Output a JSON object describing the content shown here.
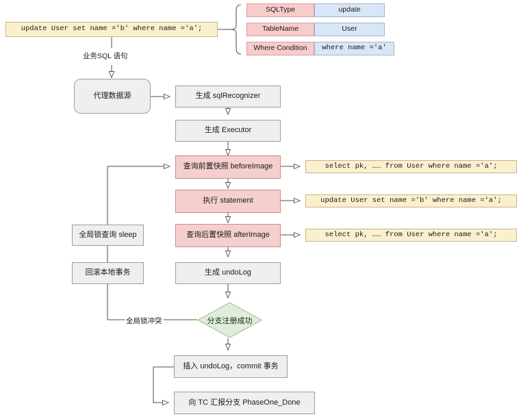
{
  "colors": {
    "gray_fill": "#efefef",
    "gray_border": "#9c9c9c",
    "pink_fill": "#f5cfce",
    "pink_border": "#c98b8b",
    "yellow_fill": "#fbf0ce",
    "yellow_border": "#c5b582",
    "blue_fill": "#d9e6f5",
    "blue_border": "#9bb7d4",
    "green_fill": "#dfeeda",
    "green_border": "#9cbf92",
    "line": "#4d4d4d"
  },
  "sql_input": {
    "label": "update User set name ='b' where name ='a';"
  },
  "parse_table": {
    "rows": [
      {
        "key": "SQLType",
        "value": "update"
      },
      {
        "key": "TableName",
        "value": "User"
      },
      {
        "key": "Where Condition",
        "value": "where name ='a'"
      }
    ]
  },
  "edges": {
    "business_sql": "业务SQL 语句",
    "global_lock_conflict": "全局锁冲突"
  },
  "nodes": {
    "proxy_datasource": "代理数据源",
    "gen_sql_recognizer": "生成 sqlRecognizer",
    "gen_executor": "生成 Executor",
    "before_image": "查询前置快照 beforeImage",
    "exec_statement": "执行 statement",
    "after_image": "查询后置快照 afterImage",
    "gen_undolog": "生成 undoLog",
    "global_lock_sleep": "全局锁查询 sleep",
    "rollback_local_tx": "回滚本地事务",
    "branch_register_ok": "分支注册成功",
    "insert_undolog_commit": "插入 undoLog，commit 事务",
    "report_phase_one_done": "向 TC 汇报分支 PhaseOne_Done"
  },
  "sql_outputs": {
    "before_image_sql": "select pk, …… from User where name ='a';",
    "statement_sql": "update User set name ='b' where name ='a';",
    "after_image_sql": "select pk, …… from User where name ='a';"
  }
}
